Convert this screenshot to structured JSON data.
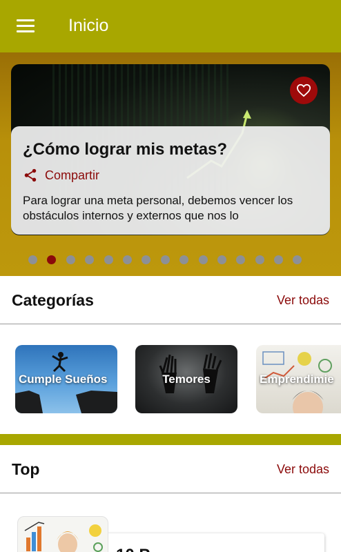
{
  "appbar": {
    "title": "Inicio"
  },
  "hero": {
    "title": "¿Cómo lograr mis metas?",
    "share_label": "Compartir",
    "description": "Para lograr una meta personal, debemos vencer los obstáculos internos y externos que nos lo",
    "dots_total": 15,
    "active_dot": 1
  },
  "categories": {
    "title": "Categorías",
    "see_all": "Ver todas",
    "items": [
      {
        "label": "Cumple Sueños"
      },
      {
        "label": "Temores"
      },
      {
        "label": "Emprendimie"
      }
    ]
  },
  "top": {
    "title": "Top",
    "see_all": "Ver todas",
    "first_item_title": "10 P"
  },
  "colors": {
    "appbar": "#a8a700",
    "accent": "#8b0a0a",
    "hero_bg": "#b8900a"
  }
}
